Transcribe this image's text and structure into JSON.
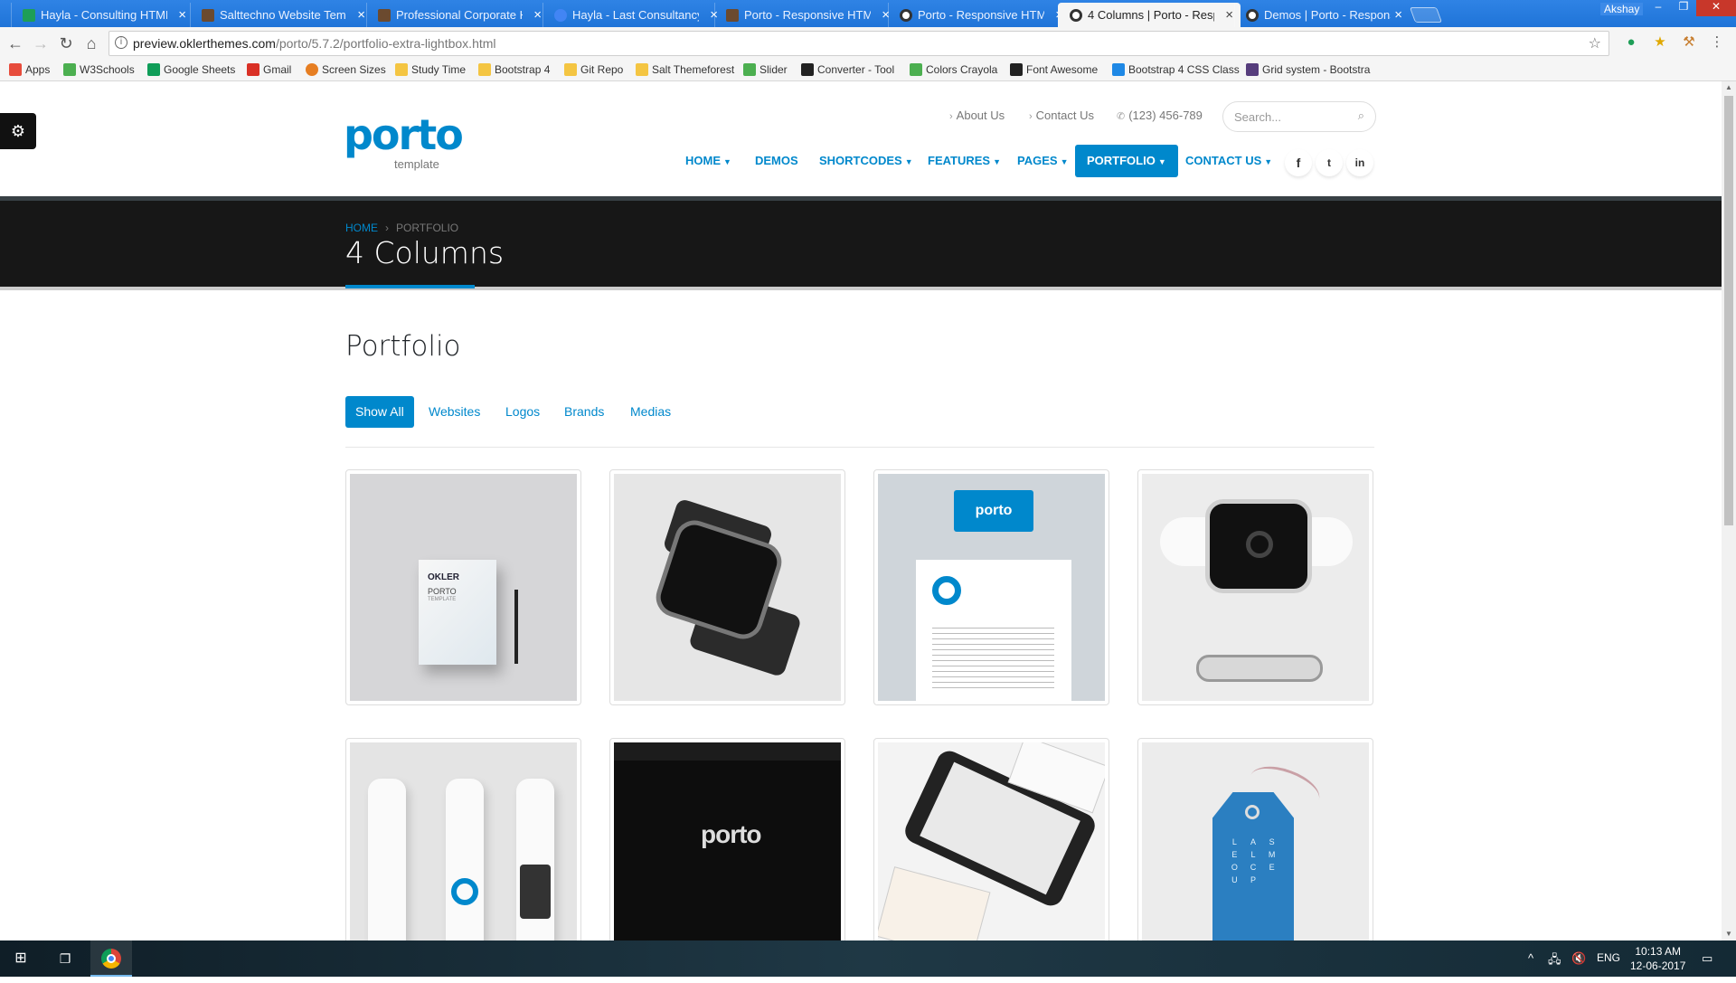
{
  "browser": {
    "tabs": [
      {
        "title": "Hayla - Consulting HTML",
        "color": "#1e9e57"
      },
      {
        "title": "Salttechno Website Temp",
        "color": "#6b4a2f"
      },
      {
        "title": "Professional Corporate H",
        "color": "#6b4a2f"
      },
      {
        "title": "Hayla - Last Consultancy",
        "color": "#4285f4"
      },
      {
        "title": "Porto - Responsive HTML",
        "color": "#6b4a2f"
      },
      {
        "title": "Porto - Responsive HTML",
        "color": "#333333"
      },
      {
        "title": "4 Columns | Porto - Resp",
        "color": "#333333"
      },
      {
        "title": "Demos | Porto - Respons",
        "color": "#333333"
      }
    ],
    "user": "Akshay",
    "url_host": "preview.oklerthemes.com",
    "url_path": "/porto/5.7.2/portfolio-extra-lightbox.html",
    "bookmarks": [
      {
        "label": "Apps",
        "color": "#e74c3c"
      },
      {
        "label": "W3Schools",
        "color": "#4caf50"
      },
      {
        "label": "Google Sheets",
        "color": "#0f9d58"
      },
      {
        "label": "Gmail",
        "color": "#d93025"
      },
      {
        "label": "Screen Sizes",
        "color": "#e67e22"
      },
      {
        "label": "Study Time",
        "color": "#f4c542"
      },
      {
        "label": "Bootstrap 4",
        "color": "#f4c542"
      },
      {
        "label": "Git Repo",
        "color": "#f4c542"
      },
      {
        "label": "Salt Themeforest",
        "color": "#f4c542"
      },
      {
        "label": "Slider",
        "color": "#4caf50"
      },
      {
        "label": "Converter - Tool",
        "color": "#222222"
      },
      {
        "label": "Colors Crayola",
        "color": "#4caf50"
      },
      {
        "label": "Font Awesome",
        "color": "#222222"
      },
      {
        "label": "Bootstrap 4 CSS Class",
        "color": "#1e88e5"
      },
      {
        "label": "Grid system - Bootstra",
        "color": "#563d7c"
      }
    ]
  },
  "site": {
    "logo_main": "porto",
    "logo_sub": "template",
    "top_links": [
      "About Us",
      "Contact Us"
    ],
    "phone": "(123) 456-789",
    "search_placeholder": "Search...",
    "nav": [
      "HOME",
      "DEMOS",
      "SHORTCODES",
      "FEATURES",
      "PAGES",
      "PORTFOLIO",
      "CONTACT US"
    ],
    "nav_active": "PORTFOLIO",
    "social": [
      "f",
      "t",
      "in"
    ],
    "breadcrumb": {
      "home": "HOME",
      "current": "PORTFOLIO"
    },
    "page_title": "4 Columns",
    "section_title": "Portfolio",
    "filters": [
      "Show All",
      "Websites",
      "Logos",
      "Brands",
      "Medias"
    ],
    "filter_active": "Show All",
    "accent_color": "#0088cc",
    "thumb_card_text": "porto",
    "thumb_tag_letters": [
      "L",
      "A",
      "S",
      "E",
      "L",
      "M",
      "O",
      "C",
      "E",
      "U",
      "P"
    ],
    "thumb_doc": {
      "brand": "OKLER",
      "title": "PORTO",
      "sub": "TEMPLATE"
    }
  },
  "taskbar": {
    "lang": "ENG",
    "time": "10:13 AM",
    "date": "12-06-2017"
  }
}
